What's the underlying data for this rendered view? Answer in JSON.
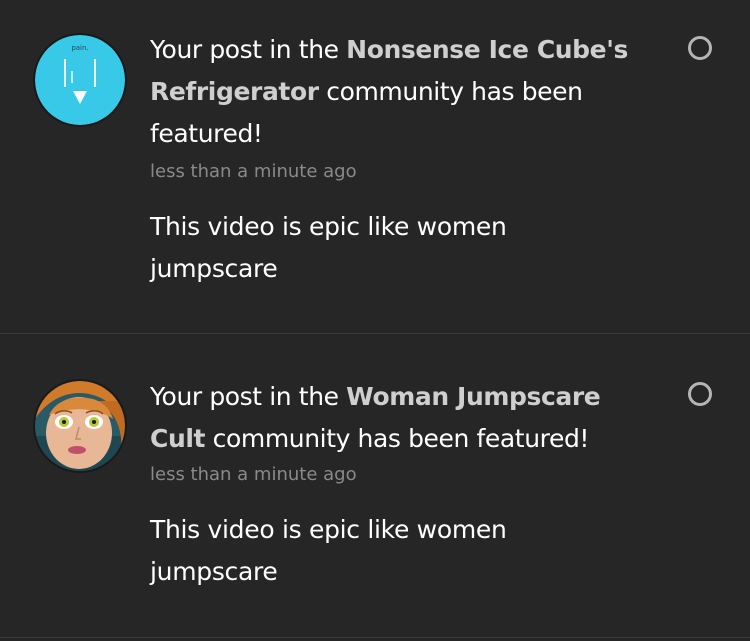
{
  "notifications": [
    {
      "headline_prefix": "Your post in the ",
      "community": "Nonsense Ice Cube's Refrigerator",
      "headline_suffix": " community has been featured!",
      "time": "less than a minute ago",
      "body": "This video is epic like women jumpscare",
      "avatar_caption": "pain.",
      "avatar_icon": "ice-cube-drawing",
      "avatar_bg": "#38c8e8",
      "unread_ring_color": "#b5b5b5"
    },
    {
      "headline_prefix": "Your post in the ",
      "community": "Woman Jumpscare Cult",
      "headline_suffix": " community has been featured!",
      "time": "less than a minute ago",
      "body": "This video is epic like women jumpscare",
      "avatar_icon": "cartoon-woman-face",
      "unread_ring_color": "#b5b5b5"
    }
  ],
  "colors": {
    "background": "#262626",
    "divider": "#3a3a3a",
    "text": "#ffffff",
    "community_text": "#cfcfcf",
    "muted_text": "#8a8a8a"
  }
}
